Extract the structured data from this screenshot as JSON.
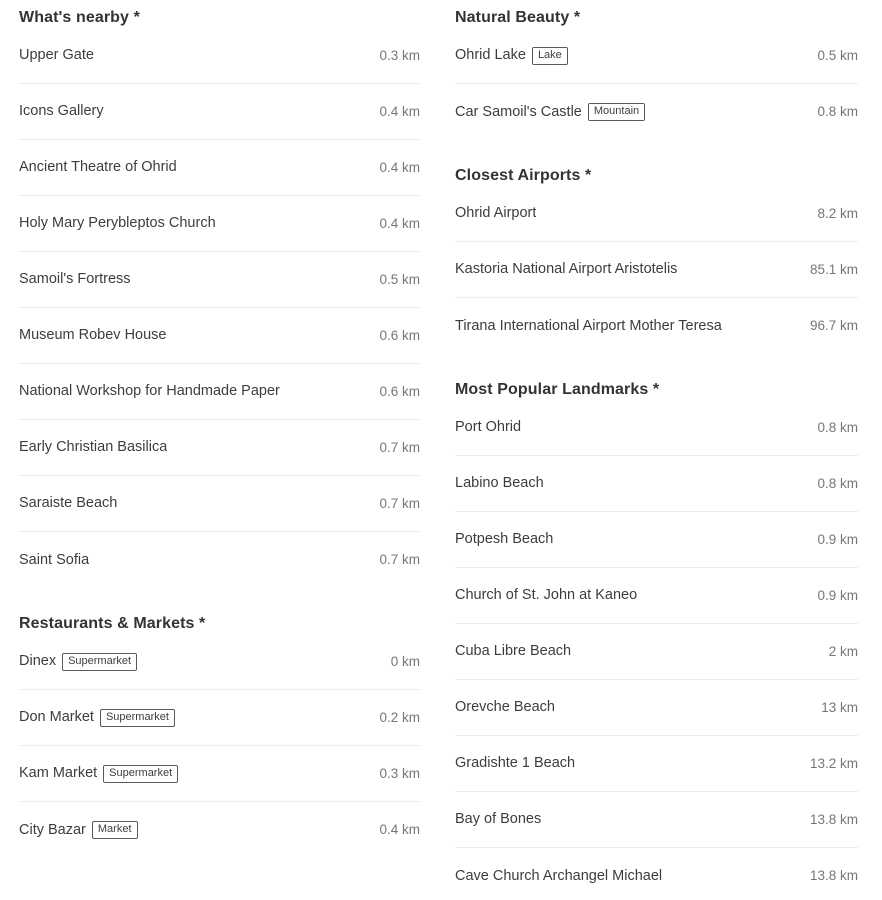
{
  "columns": [
    {
      "id": "left-column",
      "sections": [
        {
          "id": "whats-nearby",
          "title": "What's nearby *",
          "items": [
            {
              "name": "Upper Gate",
              "badge": "",
              "distance": "0.3 km"
            },
            {
              "name": "Icons Gallery",
              "badge": "",
              "distance": "0.4 km"
            },
            {
              "name": "Ancient Theatre of Ohrid",
              "badge": "",
              "distance": "0.4 km"
            },
            {
              "name": "Holy Mary Perybleptos Church",
              "badge": "",
              "distance": "0.4 km"
            },
            {
              "name": "Samoil's Fortress",
              "badge": "",
              "distance": "0.5 km"
            },
            {
              "name": "Museum Robev House",
              "badge": "",
              "distance": "0.6 km"
            },
            {
              "name": "National Workshop for Handmade Paper",
              "badge": "",
              "distance": "0.6 km"
            },
            {
              "name": "Early Christian Basilica",
              "badge": "",
              "distance": "0.7 km"
            },
            {
              "name": "Saraiste Beach",
              "badge": "",
              "distance": "0.7 km"
            },
            {
              "name": "Saint Sofia",
              "badge": "",
              "distance": "0.7 km"
            }
          ]
        },
        {
          "id": "restaurants-and-markets",
          "title": "Restaurants & Markets *",
          "items": [
            {
              "name": "Dinex",
              "badge": "Supermarket",
              "distance": "0 km"
            },
            {
              "name": "Don Market",
              "badge": "Supermarket",
              "distance": "0.2 km"
            },
            {
              "name": "Kam Market",
              "badge": "Supermarket",
              "distance": "0.3 km"
            },
            {
              "name": "City Bazar",
              "badge": "Market",
              "distance": "0.4 km"
            }
          ]
        }
      ]
    },
    {
      "id": "right-column",
      "sections": [
        {
          "id": "natural-beauty",
          "title": "Natural Beauty *",
          "items": [
            {
              "name": "Ohrid Lake",
              "badge": "Lake",
              "distance": "0.5 km"
            },
            {
              "name": "Car Samoil's Castle",
              "badge": "Mountain",
              "distance": "0.8 km"
            }
          ]
        },
        {
          "id": "closest-airports",
          "title": "Closest Airports *",
          "items": [
            {
              "name": "Ohrid Airport",
              "badge": "",
              "distance": "8.2 km"
            },
            {
              "name": "Kastoria National Airport Aristotelis",
              "badge": "",
              "distance": "85.1 km"
            },
            {
              "name": "Tirana International Airport Mother Teresa",
              "badge": "",
              "distance": "96.7 km"
            }
          ]
        },
        {
          "id": "most-popular-landmarks",
          "title": "Most Popular Landmarks *",
          "items": [
            {
              "name": "Port Ohrid",
              "badge": "",
              "distance": "0.8 km"
            },
            {
              "name": "Labino Beach",
              "badge": "",
              "distance": "0.8 km"
            },
            {
              "name": "Potpesh Beach",
              "badge": "",
              "distance": "0.9 km"
            },
            {
              "name": "Church of St. John at Kaneo",
              "badge": "",
              "distance": "0.9 km"
            },
            {
              "name": "Cuba Libre Beach",
              "badge": "",
              "distance": "2 km"
            },
            {
              "name": "Orevche Beach",
              "badge": "",
              "distance": "13 km"
            },
            {
              "name": "Gradishte 1 Beach",
              "badge": "",
              "distance": "13.2 km"
            },
            {
              "name": "Bay of Bones",
              "badge": "",
              "distance": "13.8 km"
            },
            {
              "name": "Cave Church Archangel Michael",
              "badge": "",
              "distance": "13.8 km"
            }
          ]
        }
      ]
    }
  ],
  "colors": {
    "background": "#ffffff",
    "heading": "#333333",
    "label": "#3d3d3d",
    "distance": "#767676",
    "divider": "#ededed",
    "badge_border": "#59595c"
  }
}
